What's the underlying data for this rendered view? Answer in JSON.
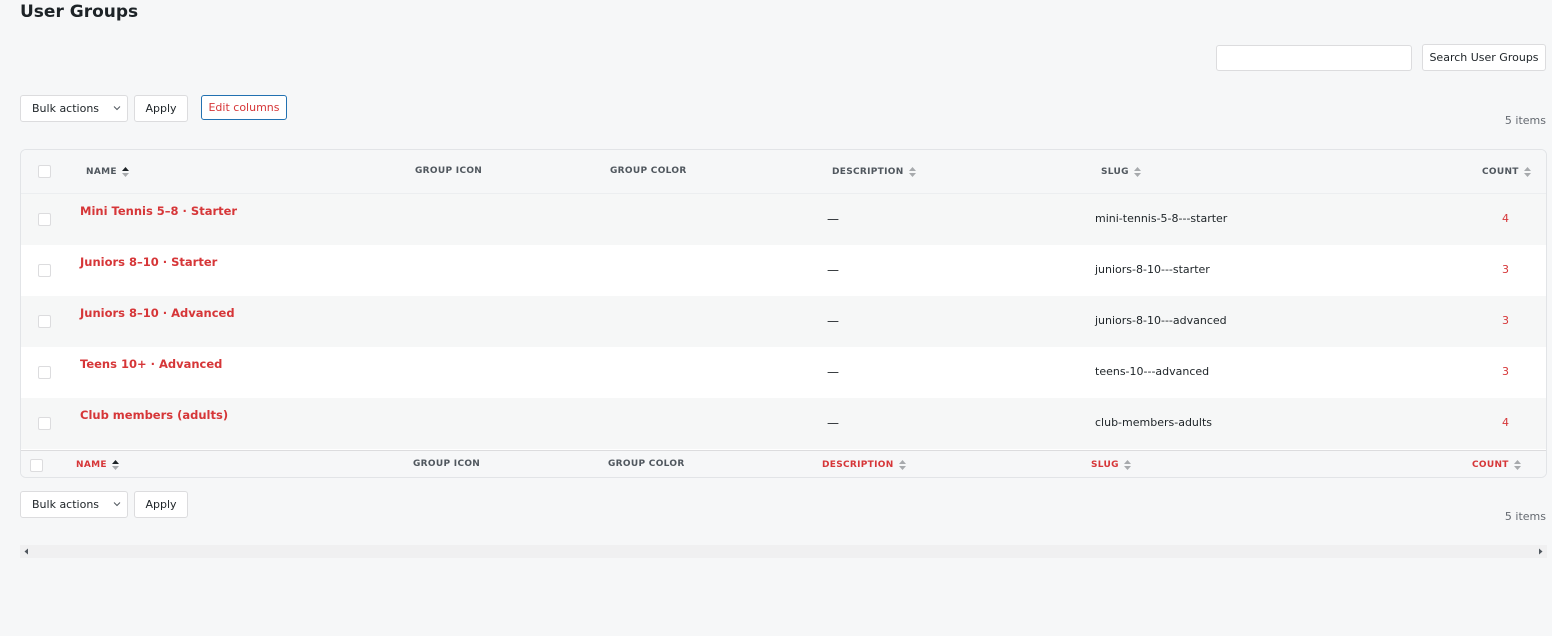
{
  "page": {
    "title": "User Groups"
  },
  "search": {
    "placeholder": "",
    "value": "",
    "button_label": "Search User Groups"
  },
  "toolbar_top": {
    "bulk_label": "Bulk actions",
    "apply_label": "Apply",
    "edit_columns_label": "Edit columns",
    "items_count": "5 items"
  },
  "toolbar_bottom": {
    "bulk_label": "Bulk actions",
    "apply_label": "Apply",
    "items_count": "5 items"
  },
  "columns": {
    "name": "NAME",
    "group_icon": "GROUP ICON",
    "group_color": "GROUP COLOR",
    "description": "DESCRIPTION",
    "slug": "SLUG",
    "count": "COUNT"
  },
  "rows": [
    {
      "name": "Mini Tennis 5–8 · Starter",
      "description": "—",
      "slug": "mini-tennis-5-8---starter",
      "count": "4"
    },
    {
      "name": "Juniors 8–10 · Starter",
      "description": "—",
      "slug": "juniors-8-10---starter",
      "count": "3"
    },
    {
      "name": "Juniors 8–10 · Advanced",
      "description": "—",
      "slug": "juniors-8-10---advanced",
      "count": "3"
    },
    {
      "name": "Teens 10+ · Advanced",
      "description": "—",
      "slug": "teens-10---advanced",
      "count": "3"
    },
    {
      "name": "Club members (adults)",
      "description": "—",
      "slug": "club-members-adults",
      "count": "4"
    }
  ],
  "colors": {
    "accent": "#d63638",
    "link_border": "#2271b1",
    "background": "#f6f7f8"
  },
  "icons": {
    "sort": "sort-arrows-icon",
    "select": "chevron-down-icon",
    "scroll_left": "scroll-left-icon",
    "scroll_right": "scroll-right-icon"
  }
}
